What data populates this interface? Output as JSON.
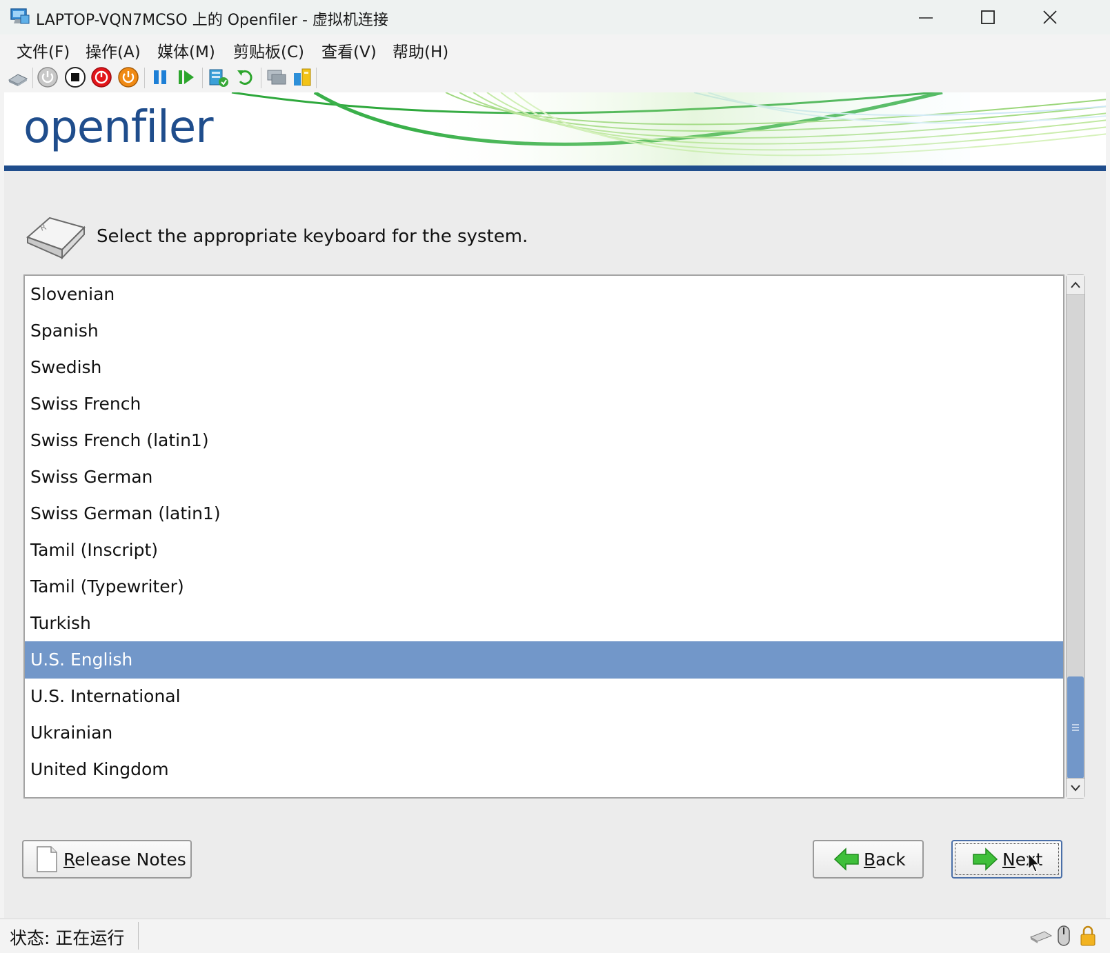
{
  "window": {
    "title": "LAPTOP-VQN7MCSO 上的 Openfiler - 虚拟机连接",
    "controls": {
      "minimize": "—",
      "maximize": "☐",
      "close": "✕"
    }
  },
  "menu": {
    "items": [
      "文件(F)",
      "操作(A)",
      "媒体(M)",
      "剪贴板(C)",
      "查看(V)",
      "帮助(H)"
    ]
  },
  "toolbar": {
    "icons": [
      "ctrl-alt-del-icon",
      "start-icon",
      "turn-off-icon",
      "shutdown-icon",
      "save-icon",
      "pause-icon",
      "resume-icon",
      "checkpoint-icon",
      "revert-icon",
      "enhanced-session-icon",
      "share-icon"
    ]
  },
  "installer": {
    "logo": "openfiler",
    "prompt": "Select the appropriate keyboard for the system.",
    "keyboards": [
      "Slovenian",
      "Spanish",
      "Swedish",
      "Swiss French",
      "Swiss French (latin1)",
      "Swiss German",
      "Swiss German (latin1)",
      "Tamil (Inscript)",
      "Tamil (Typewriter)",
      "Turkish",
      "U.S. English",
      "U.S. International",
      "Ukrainian",
      "United Kingdom"
    ],
    "selected": "U.S. English",
    "buttons": {
      "release_notes": {
        "accel": "R",
        "rest": "elease Notes"
      },
      "back": {
        "accel": "B",
        "rest": "ack"
      },
      "next": {
        "accel": "N",
        "rest": "ext"
      }
    },
    "colors": {
      "selection": "#7297c9",
      "brand_blue": "#1f4d8c",
      "swoosh_green": "#38b54a"
    }
  },
  "status": {
    "text": "状态: 正在运行"
  }
}
